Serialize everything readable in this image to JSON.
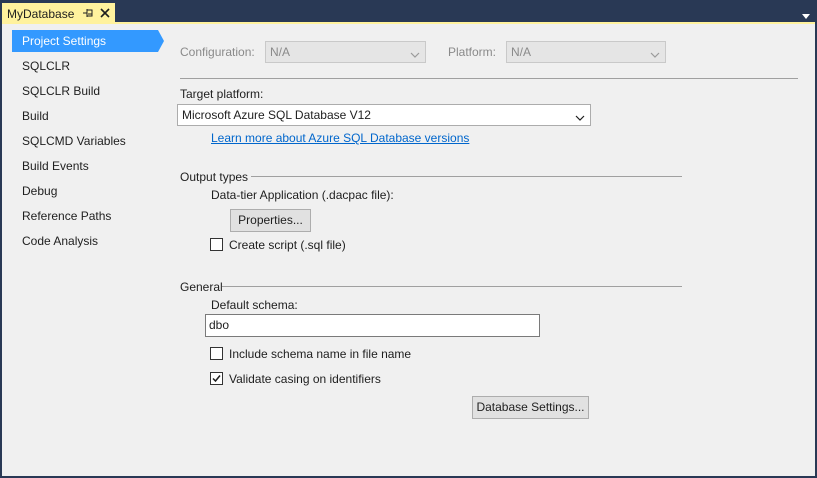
{
  "tab": {
    "title": "MyDatabase"
  },
  "nav": {
    "items": [
      {
        "label": "Project Settings",
        "selected": true
      },
      {
        "label": "SQLCLR"
      },
      {
        "label": "SQLCLR Build"
      },
      {
        "label": "Build"
      },
      {
        "label": "SQLCMD Variables"
      },
      {
        "label": "Build Events"
      },
      {
        "label": "Debug"
      },
      {
        "label": "Reference Paths"
      },
      {
        "label": "Code Analysis"
      }
    ]
  },
  "config": {
    "configuration_label": "Configuration:",
    "configuration_value": "N/A",
    "platform_label": "Platform:",
    "platform_value": "N/A"
  },
  "target": {
    "label": "Target platform:",
    "value": "Microsoft Azure SQL Database V12",
    "link": "Learn more about Azure SQL Database versions"
  },
  "output": {
    "heading": "Output types",
    "dacpac_label": "Data-tier Application (.dacpac file):",
    "properties_button": "Properties...",
    "create_script_label": "Create script (.sql file)",
    "create_script_checked": false
  },
  "general": {
    "heading": "General",
    "default_schema_label": "Default schema:",
    "default_schema_value": "dbo",
    "include_schema_label": "Include schema name in file name",
    "include_schema_checked": false,
    "validate_casing_label": "Validate casing on identifiers",
    "validate_casing_checked": true,
    "database_settings_button": "Database Settings..."
  },
  "colors": {
    "accent": "#3399ff",
    "tab_active": "#fff29d",
    "frame": "#293955",
    "link": "#0066cc"
  }
}
